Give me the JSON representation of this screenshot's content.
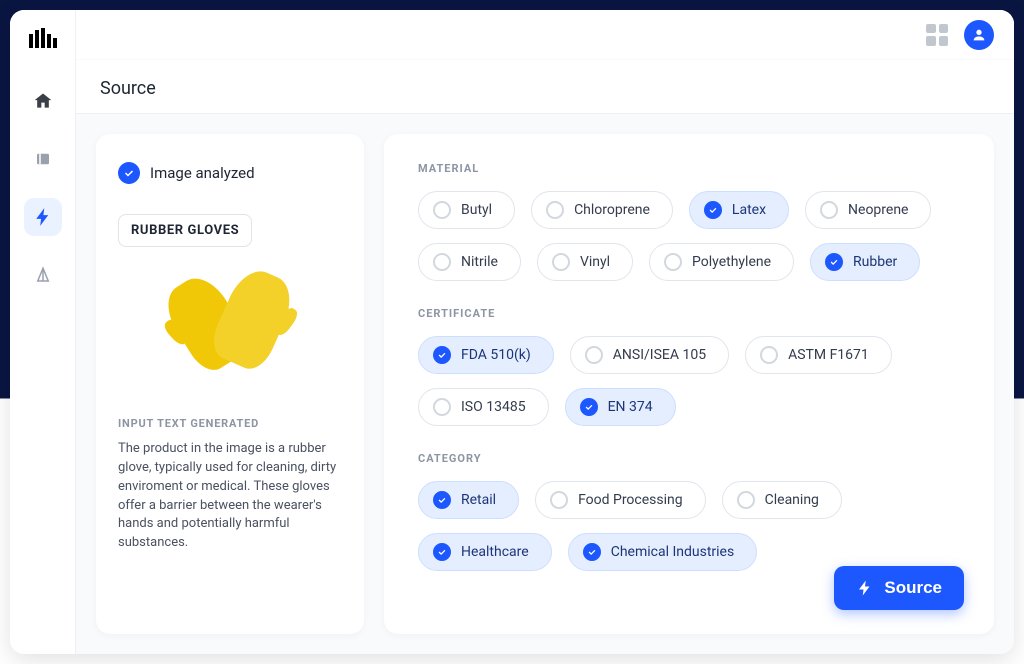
{
  "page_title": "Source",
  "analyzed_label": "Image analyzed",
  "product_label": "RUBBER GLOVES",
  "generated_heading": "INPUT TEXT GENERATED",
  "generated_text": "The product in the image is a rubber glove, typically used for cleaning, dirty enviroment or medical. These gloves offer a barrier between the wearer's hands and potentially harmful substances.",
  "source_button": "Source",
  "sections": {
    "material": {
      "heading": "MATERIAL",
      "items": [
        {
          "label": "Butyl",
          "selected": false
        },
        {
          "label": "Chloroprene",
          "selected": false
        },
        {
          "label": "Latex",
          "selected": true
        },
        {
          "label": "Neoprene",
          "selected": false
        },
        {
          "label": "Nitrile",
          "selected": false
        },
        {
          "label": "Vinyl",
          "selected": false
        },
        {
          "label": "Polyethylene",
          "selected": false
        },
        {
          "label": "Rubber",
          "selected": true
        }
      ]
    },
    "certificate": {
      "heading": "CERTIFICATE",
      "items": [
        {
          "label": "FDA 510(k)",
          "selected": true
        },
        {
          "label": "ANSI/ISEA 105",
          "selected": false
        },
        {
          "label": "ASTM F1671",
          "selected": false
        },
        {
          "label": "ISO 13485",
          "selected": false
        },
        {
          "label": "EN 374",
          "selected": true
        }
      ]
    },
    "category": {
      "heading": "CATEGORY",
      "items": [
        {
          "label": "Retail",
          "selected": true
        },
        {
          "label": "Food Processing",
          "selected": false
        },
        {
          "label": "Cleaning",
          "selected": false
        },
        {
          "label": "Healthcare",
          "selected": true
        },
        {
          "label": "Chemical Industries",
          "selected": true
        }
      ]
    }
  }
}
